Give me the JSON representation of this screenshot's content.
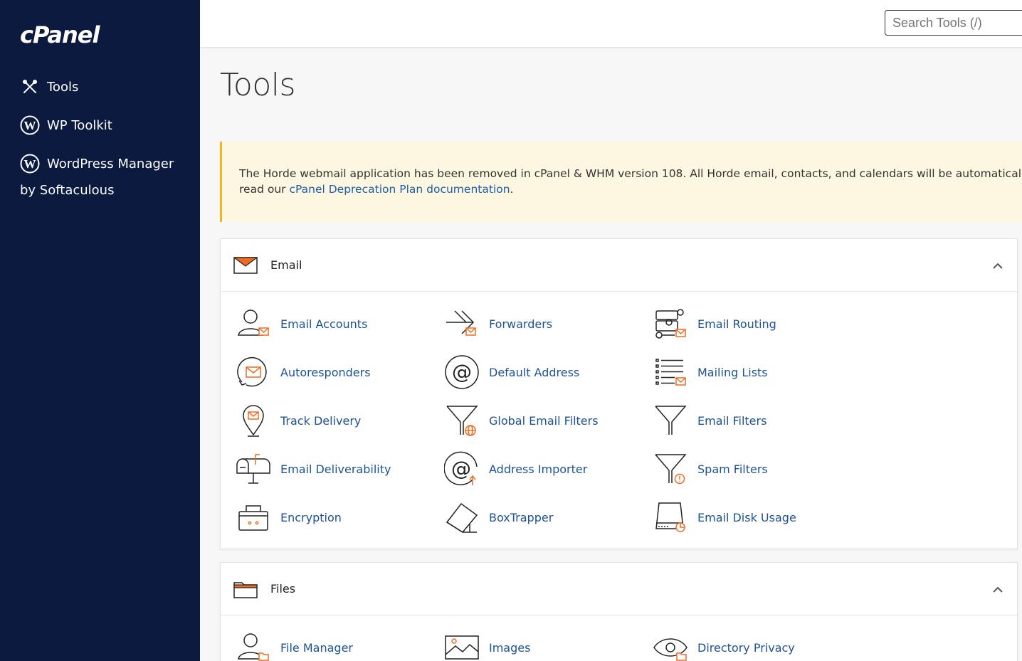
{
  "sidebar": {
    "logo": "cPanel",
    "items": [
      {
        "label": "Tools"
      },
      {
        "label": "WP Toolkit"
      },
      {
        "label": "WordPress Manager"
      }
    ],
    "sub_label": "by Softaculous"
  },
  "search": {
    "placeholder": "Search Tools (/)"
  },
  "page": {
    "title": "Tools"
  },
  "alert": {
    "text": "The Horde webmail application has been removed in cPanel & WHM version 108. All Horde email, contacts, and calendars will be automatically m",
    "line2_prefix": "read our ",
    "link": "cPanel Deprecation Plan documentation",
    "line2_suffix": "."
  },
  "email_panel": {
    "title": "Email",
    "tools": [
      {
        "label": "Email Accounts",
        "icon": "user-mail-icon"
      },
      {
        "label": "Forwarders",
        "icon": "forward-arrow-icon"
      },
      {
        "label": "Email Routing",
        "icon": "routing-icon"
      },
      {
        "label": "Autoresponders",
        "icon": "autoresponder-icon"
      },
      {
        "label": "Default Address",
        "icon": "at-sign-icon"
      },
      {
        "label": "Mailing Lists",
        "icon": "list-icon"
      },
      {
        "label": "Track Delivery",
        "icon": "location-pin-icon"
      },
      {
        "label": "Global Email Filters",
        "icon": "funnel-globe-icon"
      },
      {
        "label": "Email Filters",
        "icon": "funnel-icon"
      },
      {
        "label": "Email Deliverability",
        "icon": "mailbox-icon"
      },
      {
        "label": "Address Importer",
        "icon": "at-import-icon"
      },
      {
        "label": "Spam Filters",
        "icon": "funnel-alert-icon"
      },
      {
        "label": "Encryption",
        "icon": "lock-box-icon"
      },
      {
        "label": "BoxTrapper",
        "icon": "boxtrapper-icon"
      },
      {
        "label": "Email Disk Usage",
        "icon": "disk-usage-icon"
      }
    ]
  },
  "files_panel": {
    "title": "Files",
    "tools": [
      {
        "label": "File Manager",
        "icon": "user-folder-icon"
      },
      {
        "label": "Images",
        "icon": "image-icon"
      },
      {
        "label": "Directory Privacy",
        "icon": "eye-folder-icon"
      }
    ]
  },
  "colors": {
    "sidebar_bg": "#0c1a40",
    "link": "#1d5294",
    "accent": "#f26a21",
    "alert_border": "#f0b429"
  }
}
